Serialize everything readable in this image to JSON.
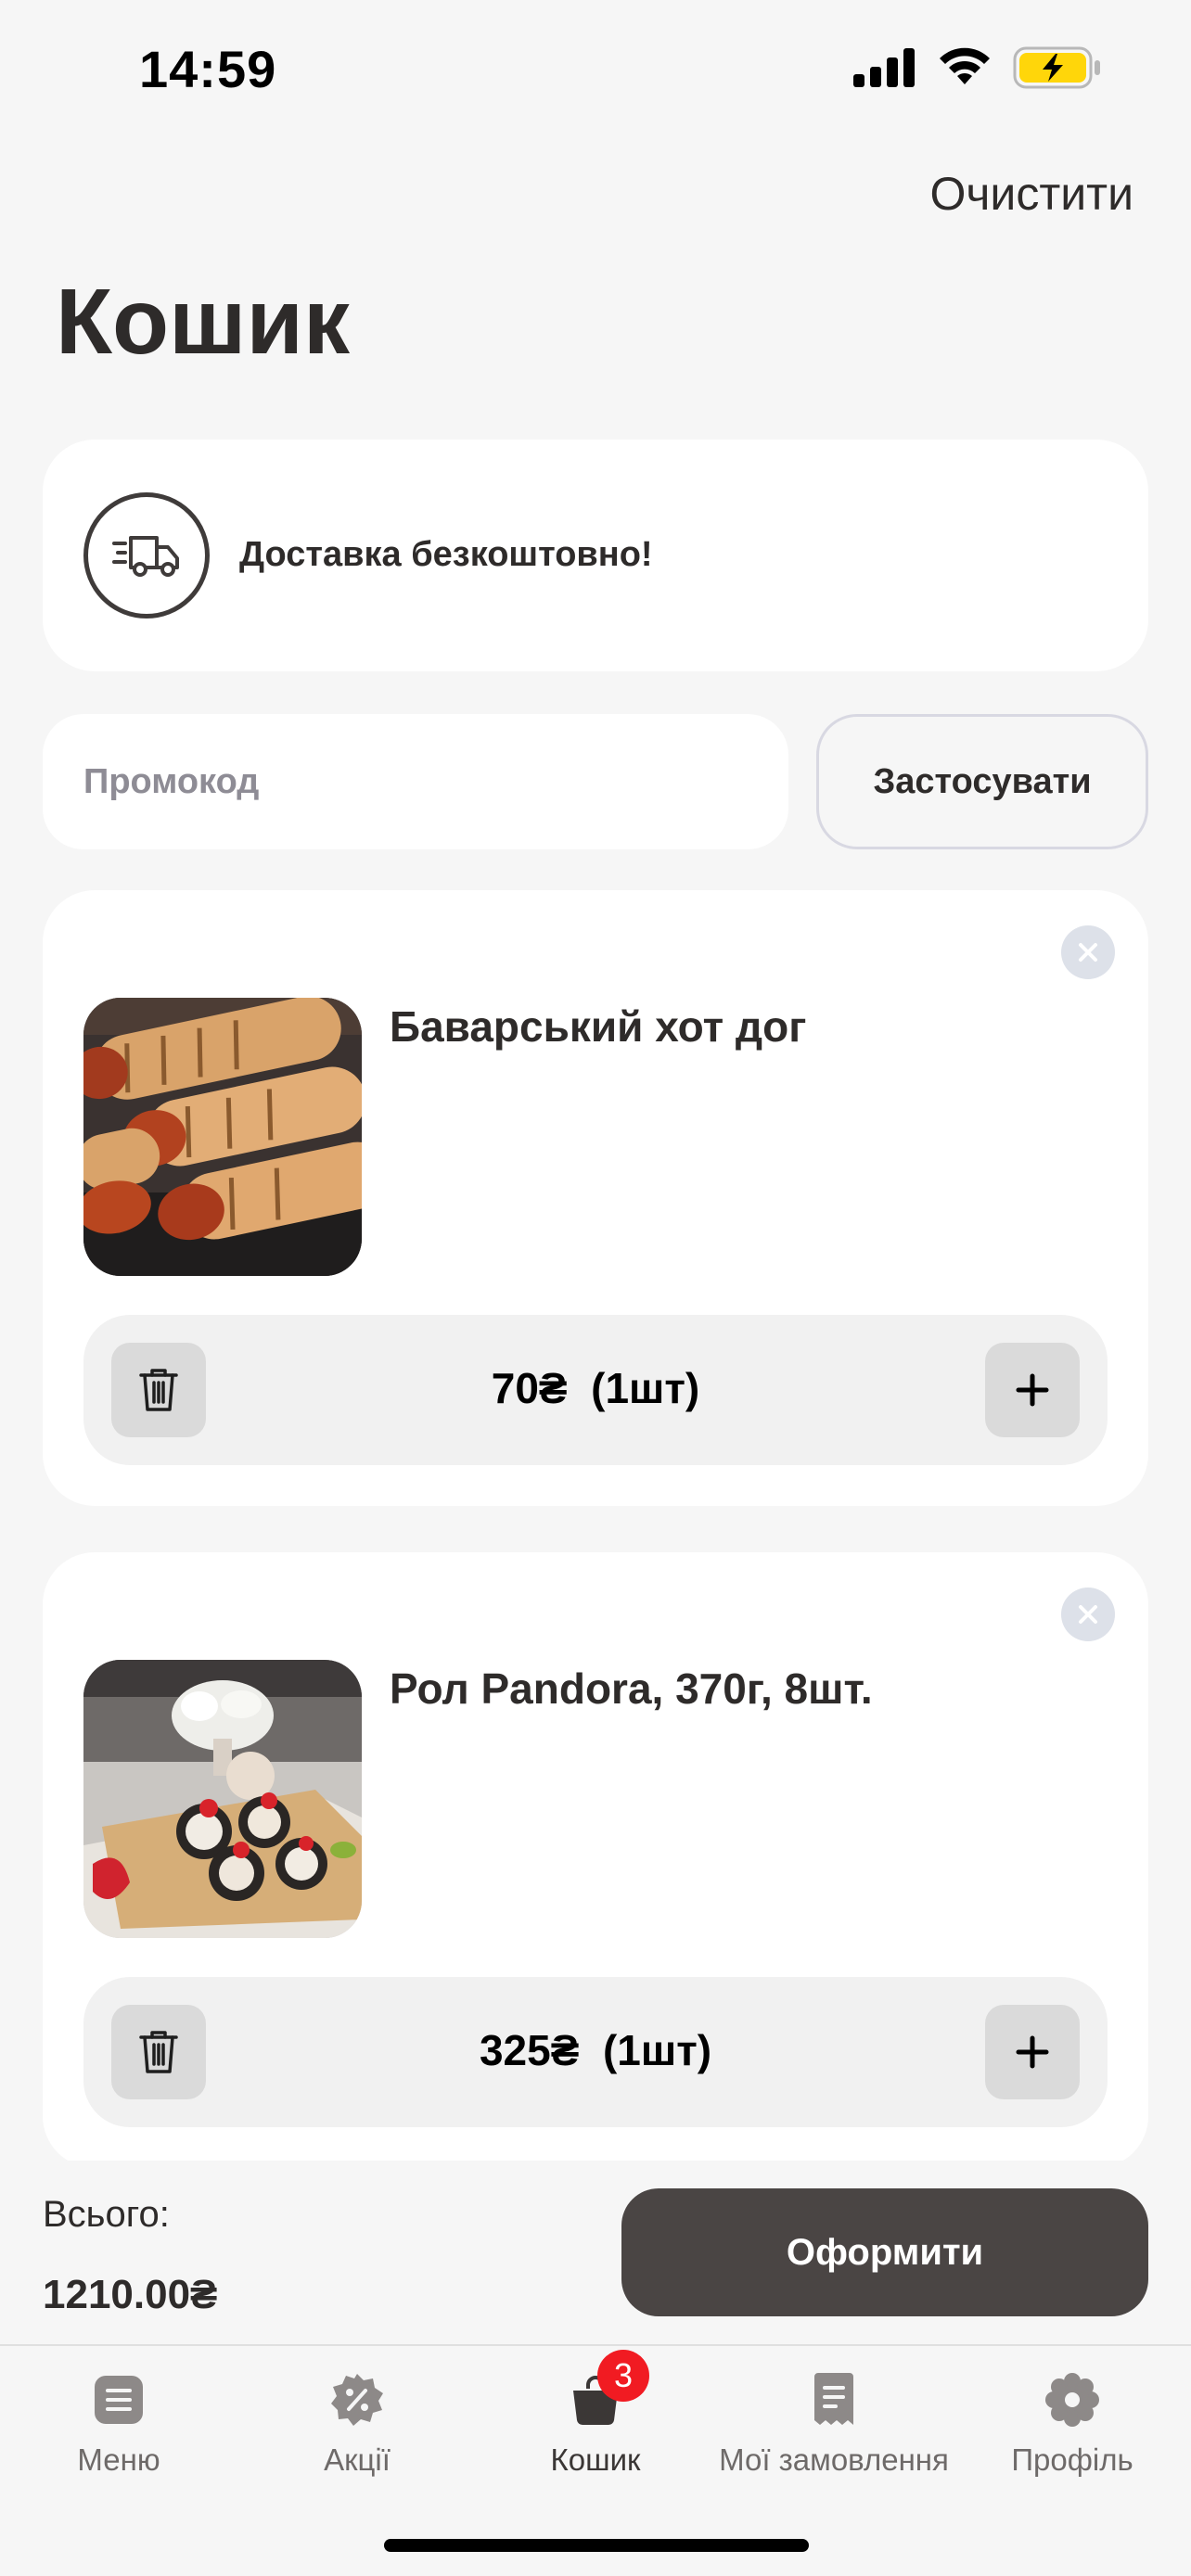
{
  "status_bar": {
    "time": "14:59"
  },
  "header": {
    "clear_label": "Очистити",
    "title": "Кошик"
  },
  "delivery": {
    "text": "Доставка безкоштовно!",
    "icon": "truck-icon"
  },
  "promo": {
    "placeholder": "Промокод",
    "value": "",
    "apply_label": "Застосувати"
  },
  "cart_items": [
    {
      "name": "Баварський хот дог",
      "price": "70₴",
      "quantity": "(1шт)"
    },
    {
      "name": "Рол Pandora, 370г, 8шт.",
      "price": "325₴",
      "quantity": "(1шт)"
    }
  ],
  "summary": {
    "total_label": "Всього:",
    "total_value": "1210.00₴",
    "checkout_label": "Оформити"
  },
  "tabs": [
    {
      "label": "Меню",
      "icon": "menu-icon"
    },
    {
      "label": "Акції",
      "icon": "discount-icon"
    },
    {
      "label": "Кошик",
      "icon": "bag-icon",
      "badge": "3",
      "active": true
    },
    {
      "label": "Мої замовлення",
      "icon": "receipt-icon"
    },
    {
      "label": "Профіль",
      "icon": "profile-icon"
    }
  ],
  "colors": {
    "accent": "#4a4544",
    "badge": "#f11b22",
    "background": "#f6f6f6",
    "battery": "#ffd60a"
  }
}
